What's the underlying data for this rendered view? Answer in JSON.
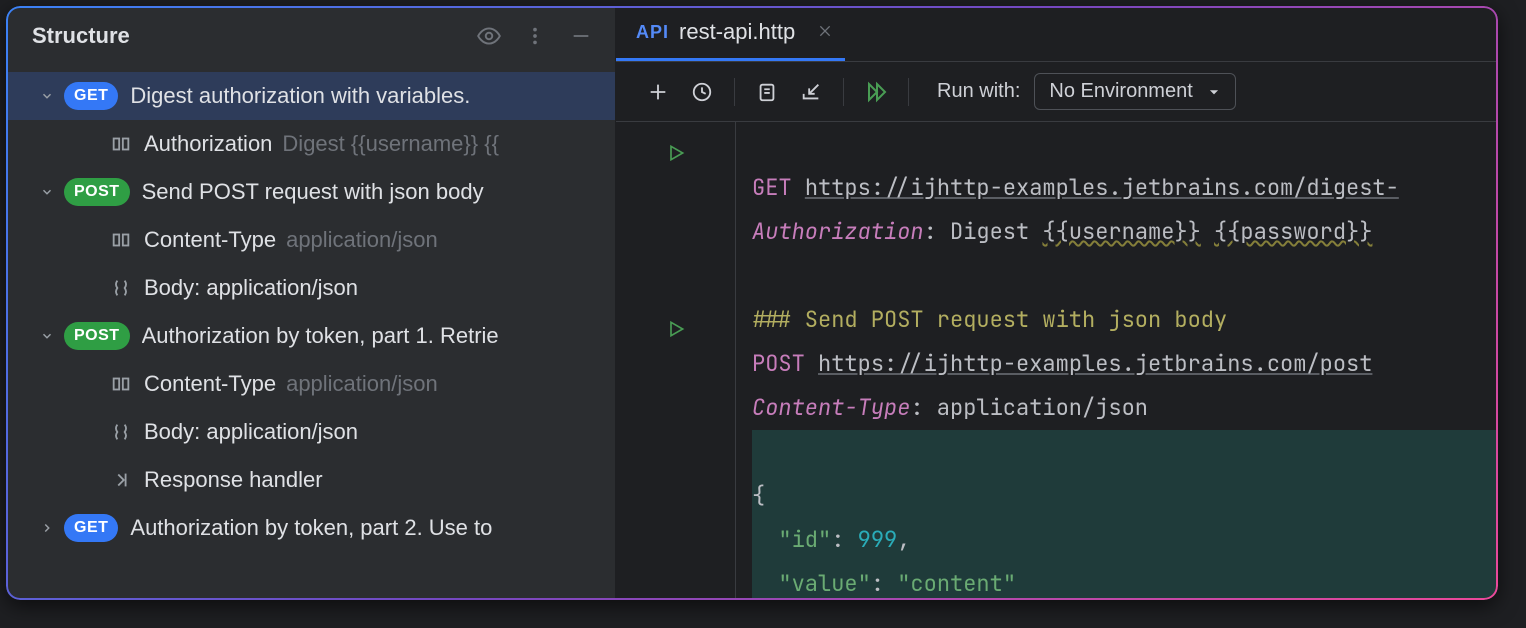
{
  "structure": {
    "title": "Structure",
    "items": [
      {
        "type": "request",
        "method": "GET",
        "label": "Digest authorization with variables.",
        "expanded": true,
        "selected": true,
        "children": [
          {
            "type": "header",
            "name": "Authorization",
            "value": "Digest {{username}} {{"
          }
        ]
      },
      {
        "type": "request",
        "method": "POST",
        "label": "Send POST request with json body",
        "expanded": true,
        "selected": false,
        "children": [
          {
            "type": "header",
            "name": "Content-Type",
            "value": "application/json"
          },
          {
            "type": "body",
            "name": "Body: application/json"
          }
        ]
      },
      {
        "type": "request",
        "method": "POST",
        "label": "Authorization by token, part 1. Retrie",
        "expanded": true,
        "selected": false,
        "children": [
          {
            "type": "header",
            "name": "Content-Type",
            "value": "application/json"
          },
          {
            "type": "body",
            "name": "Body: application/json"
          },
          {
            "type": "response",
            "name": "Response handler"
          }
        ]
      },
      {
        "type": "request",
        "method": "GET",
        "label": "Authorization by token, part 2. Use to",
        "expanded": false,
        "selected": false,
        "children": []
      }
    ]
  },
  "tab": {
    "prefix": "API",
    "name": "rest-api.http"
  },
  "toolbar": {
    "run_with": "Run with:",
    "env": "No Environment"
  },
  "code": {
    "get_method": "GET",
    "get_url": "https://ijhttp-examples.jetbrains.com/digest-",
    "auth_header": "Authorization",
    "auth_value_prefix": ": Digest ",
    "auth_user": "{{username}}",
    "auth_pass": "{{password}}",
    "comment": "### Send POST request with json body",
    "post_method": "POST",
    "post_url": "https://ijhttp-examples.jetbrains.com/post",
    "ct_header": "Content-Type",
    "ct_value": ": application/json",
    "json_open": "{",
    "json_l1_key": "\"id\"",
    "json_l1_sep": ": ",
    "json_l1_val": "999",
    "json_l1_comma": ",",
    "json_l2_key": "\"value\"",
    "json_l2_sep": ": ",
    "json_l2_val": "\"content\""
  }
}
